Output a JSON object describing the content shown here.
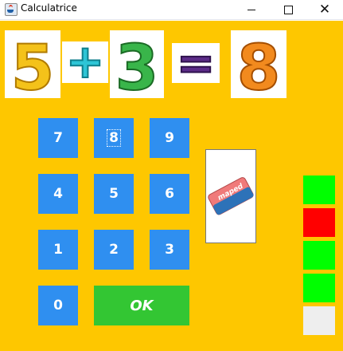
{
  "window": {
    "title": "Calculatrice",
    "minimize_icon": "minimize-icon",
    "maximize_icon": "maximize-icon",
    "close_icon": "close-icon"
  },
  "equation": {
    "operand_a": "5",
    "operator": "+",
    "operand_b": "3",
    "equals": "=",
    "answer": "8",
    "colors": {
      "five": "#f4c21a",
      "plus": "#2dc5d6",
      "three": "#39b54a",
      "equals": "#5b2b87",
      "eight": "#f28a1e"
    }
  },
  "keypad": {
    "rows": [
      [
        "7",
        "8",
        "9"
      ],
      [
        "4",
        "5",
        "6"
      ],
      [
        "1",
        "2",
        "3"
      ]
    ],
    "zero": "0",
    "ok_label": "OK",
    "focused_key": "8",
    "colors": {
      "key": "#2f8ff0",
      "ok": "#33c633",
      "background": "#fec700"
    }
  },
  "eraser": {
    "brand_text": "maped",
    "icon": "eraser-icon"
  },
  "score_indicators": [
    {
      "state": "correct",
      "color": "#00ff00"
    },
    {
      "state": "wrong",
      "color": "#ff0000"
    },
    {
      "state": "correct",
      "color": "#00ff00"
    },
    {
      "state": "correct",
      "color": "#00ff00"
    },
    {
      "state": "pending",
      "color": "#eeeeee"
    }
  ]
}
